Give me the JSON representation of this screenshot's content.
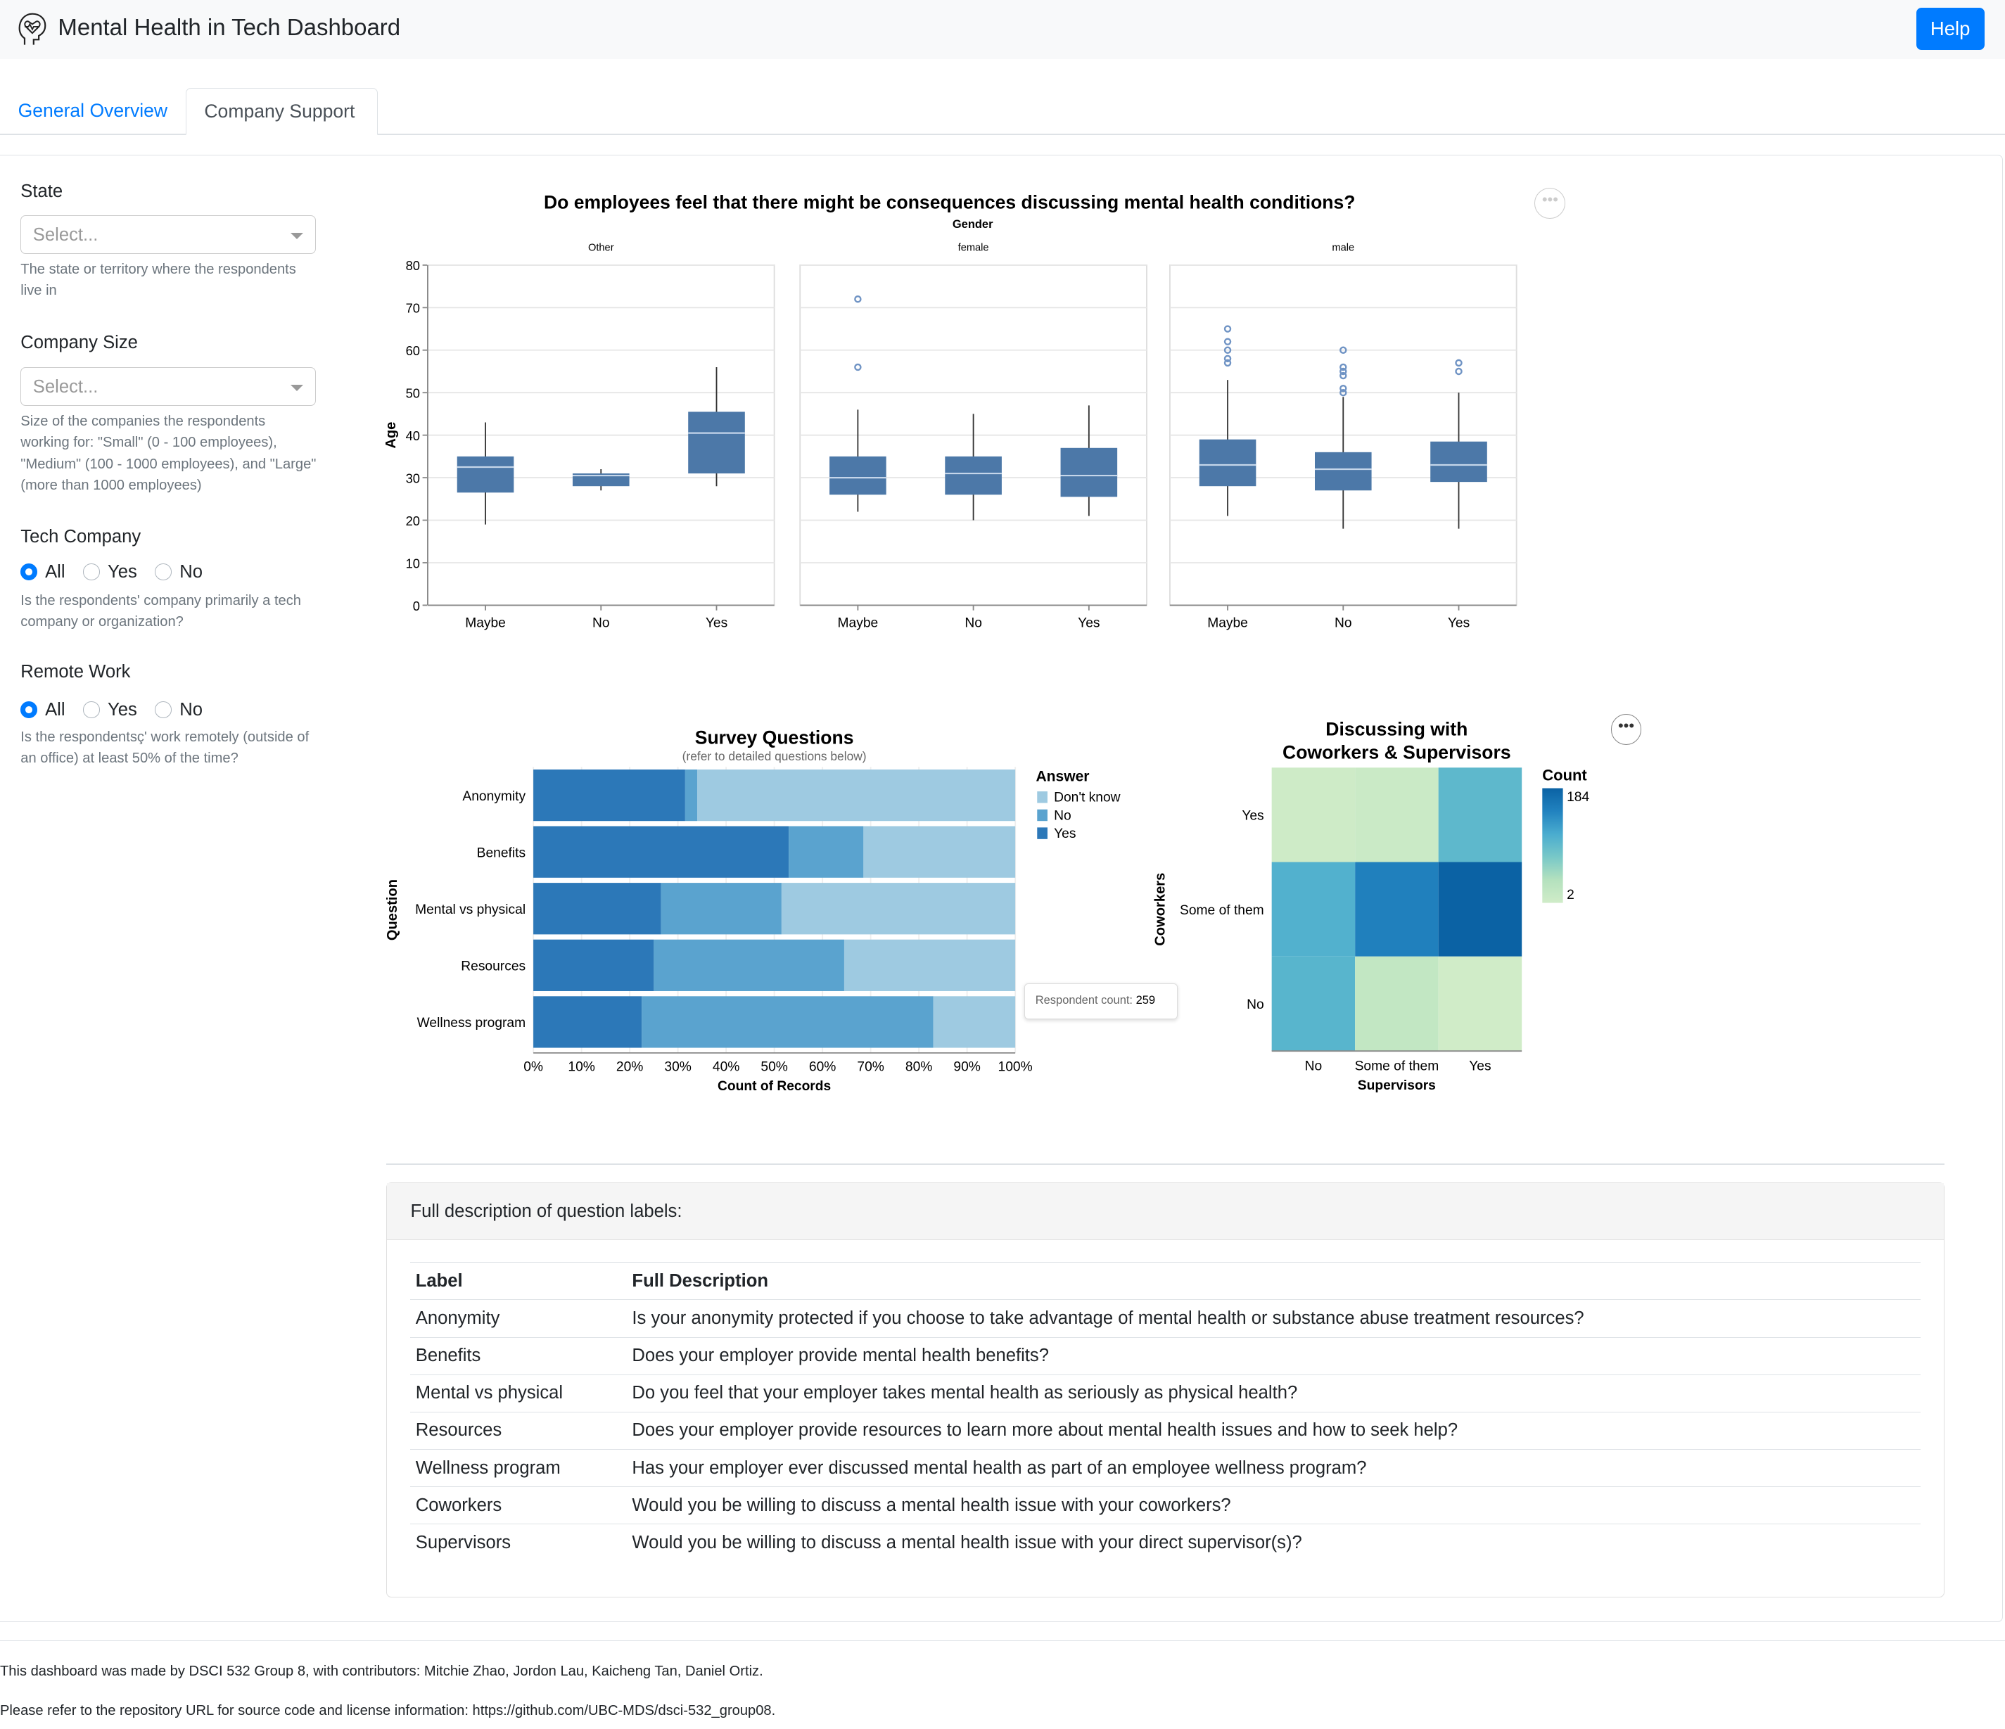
{
  "header": {
    "title": "Mental Health in Tech Dashboard",
    "help_label": "Help",
    "icon": "head-heartbeat-icon"
  },
  "tabs": [
    {
      "label": "General Overview",
      "active": false
    },
    {
      "label": "Company Support",
      "active": true
    }
  ],
  "filters": {
    "state": {
      "label": "State",
      "placeholder": "Select...",
      "help": "The state or territory where the respondents live in"
    },
    "company_size": {
      "label": "Company Size",
      "placeholder": "Select...",
      "help": "Size of the companies the respondents working for: \"Small\" (0 - 100 employees), \"Medium\" (100 - 1000 employees), and \"Large\" (more than 1000 employees)"
    },
    "tech_company": {
      "label": "Tech Company",
      "options": [
        "All",
        "Yes",
        "No"
      ],
      "selected": "All",
      "help": "Is the respondents' company primarily a tech company or organization?"
    },
    "remote_work": {
      "label": "Remote Work",
      "options": [
        "All",
        "Yes",
        "No"
      ],
      "selected": "All",
      "help": "Is the respondentsç' work remotely (outside of an office) at least 50% of the time?"
    }
  },
  "chart_data": [
    {
      "type": "boxplot",
      "title": "Do employees feel that there might be consequences discussing mental health conditions?",
      "facet_label": "Gender",
      "ylabel": "Age",
      "ylim": [
        0,
        80
      ],
      "yticks": [
        0,
        10,
        20,
        30,
        40,
        50,
        60,
        70,
        80
      ],
      "categories": [
        "Maybe",
        "No",
        "Yes"
      ],
      "color": "#4c78a8",
      "facets": [
        {
          "name": "Other",
          "boxes": [
            {
              "min": 19,
              "q1": 26.5,
              "median": 32.5,
              "q3": 35,
              "max": 43,
              "outliers": []
            },
            {
              "min": 27,
              "q1": 28,
              "median": 30.5,
              "q3": 31,
              "max": 32,
              "outliers": []
            },
            {
              "min": 28,
              "q1": 31,
              "median": 40.5,
              "q3": 45.5,
              "max": 56,
              "outliers": []
            }
          ]
        },
        {
          "name": "female",
          "boxes": [
            {
              "min": 22,
              "q1": 26,
              "median": 30,
              "q3": 35,
              "max": 46,
              "outliers": [
                72,
                56
              ]
            },
            {
              "min": 20,
              "q1": 26,
              "median": 31,
              "q3": 35,
              "max": 45,
              "outliers": []
            },
            {
              "min": 21,
              "q1": 25.5,
              "median": 30.5,
              "q3": 37,
              "max": 47,
              "outliers": []
            }
          ]
        },
        {
          "name": "male",
          "boxes": [
            {
              "min": 21,
              "q1": 28,
              "median": 33,
              "q3": 39,
              "max": 53,
              "outliers": [
                57,
                58,
                60,
                62,
                65
              ]
            },
            {
              "min": 18,
              "q1": 27,
              "median": 32,
              "q3": 36,
              "max": 49,
              "outliers": [
                50,
                51,
                54,
                55,
                56,
                60
              ]
            },
            {
              "min": 18,
              "q1": 29,
              "median": 33,
              "q3": 38.5,
              "max": 50,
              "outliers": [
                55,
                57
              ]
            }
          ]
        }
      ]
    },
    {
      "type": "bar",
      "stacked": "normalize",
      "title": "Survey Questions",
      "subtitle": "(refer to detailed questions below)",
      "xlabel": "Count of Records",
      "ylabel": "Question",
      "xticks": [
        "0%",
        "10%",
        "20%",
        "30%",
        "40%",
        "50%",
        "60%",
        "70%",
        "80%",
        "90%",
        "100%"
      ],
      "categories": [
        "Anonymity",
        "Benefits",
        "Mental vs physical",
        "Resources",
        "Wellness program"
      ],
      "legend_title": "Answer",
      "series": [
        {
          "name": "Yes",
          "color": "#2c78b8",
          "values": [
            31.5,
            53,
            26.5,
            25,
            22.5
          ]
        },
        {
          "name": "No",
          "color": "#5aa3cf",
          "values": [
            2.5,
            15.5,
            25,
            39.5,
            60.5
          ]
        },
        {
          "name": "Don't know",
          "color": "#9ecae1",
          "values": [
            66,
            31.5,
            48.5,
            35.5,
            17
          ]
        }
      ],
      "legend_order": [
        "Don't know",
        "No",
        "Yes"
      ],
      "tooltip": {
        "label": "Respondent count:",
        "value": "259"
      }
    },
    {
      "type": "heatmap",
      "title": [
        "Discussing with",
        "Coworkers & Supervisors"
      ],
      "xlabel": "Supervisors",
      "ylabel": "Coworkers",
      "x": [
        "No",
        "Some of them",
        "Yes"
      ],
      "y": [
        "Yes",
        "Some of them",
        "No"
      ],
      "values": [
        [
          5,
          10,
          95
        ],
        [
          105,
          150,
          184
        ],
        [
          100,
          20,
          2
        ]
      ],
      "legend_title": "Count",
      "legend_range": [
        2,
        184
      ]
    }
  ],
  "description": {
    "header": "Full description of question labels:",
    "columns": [
      "Label",
      "Full Description"
    ],
    "rows": [
      [
        "Anonymity",
        "Is your anonymity protected if you choose to take advantage of mental health or substance abuse treatment resources?"
      ],
      [
        "Benefits",
        "Does your employer provide mental health benefits?"
      ],
      [
        "Mental vs physical",
        "Do you feel that your employer takes mental health as seriously as physical health?"
      ],
      [
        "Resources",
        "Does your employer provide resources to learn more about mental health issues and how to seek help?"
      ],
      [
        "Wellness program",
        "Has your employer ever discussed mental health as part of an employee wellness program?"
      ],
      [
        "Coworkers",
        "Would you be willing to discuss a mental health issue with your coworkers?"
      ],
      [
        "Supervisors",
        "Would you be willing to discuss a mental health issue with your direct supervisor(s)?"
      ]
    ]
  },
  "footer": [
    "This dashboard was made by DSCI 532 Group 8, with contributors: Mitchie Zhao, Jordon Lau, Kaicheng Tan, Daniel Ortiz.",
    "Please refer to the repository URL for source code and license information: https://github.com/UBC-MDS/dsci-532_group08."
  ]
}
